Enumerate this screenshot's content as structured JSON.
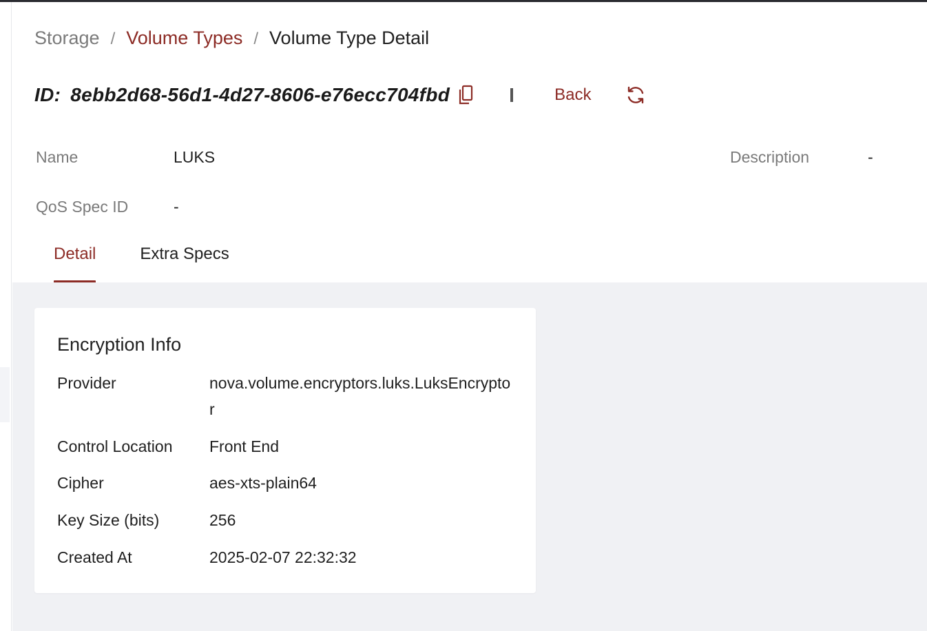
{
  "breadcrumb": {
    "root": "Storage",
    "separator": "/",
    "parent": "Volume Types",
    "current": "Volume Type Detail"
  },
  "header": {
    "id_label": "ID:",
    "id_value": "8ebb2d68-56d1-4d27-8606-e76ecc704fbd",
    "back_label": "Back"
  },
  "fields": {
    "name_label": "Name",
    "name_value": "LUKS",
    "description_label": "Description",
    "description_value": "-",
    "qos_label": "QoS Spec ID",
    "qos_value": "-"
  },
  "tabs": [
    {
      "label": "Detail",
      "active": true
    },
    {
      "label": "Extra Specs",
      "active": false
    }
  ],
  "encryption": {
    "title": "Encryption Info",
    "rows": [
      {
        "label": "Provider",
        "value": "nova.volume.encryptors.luks.LuksEncryptor"
      },
      {
        "label": "Control Location",
        "value": "Front End"
      },
      {
        "label": "Cipher",
        "value": "aes-xts-plain64"
      },
      {
        "label": "Key Size (bits)",
        "value": "256"
      },
      {
        "label": "Created At",
        "value": "2025-02-07 22:32:32"
      }
    ]
  },
  "colors": {
    "accent": "#8c2b25",
    "content_background": "#f0f1f4",
    "muted_text": "#7a7a7a"
  },
  "icons": {
    "copy": "copy-icon",
    "refresh": "refresh-icon"
  }
}
